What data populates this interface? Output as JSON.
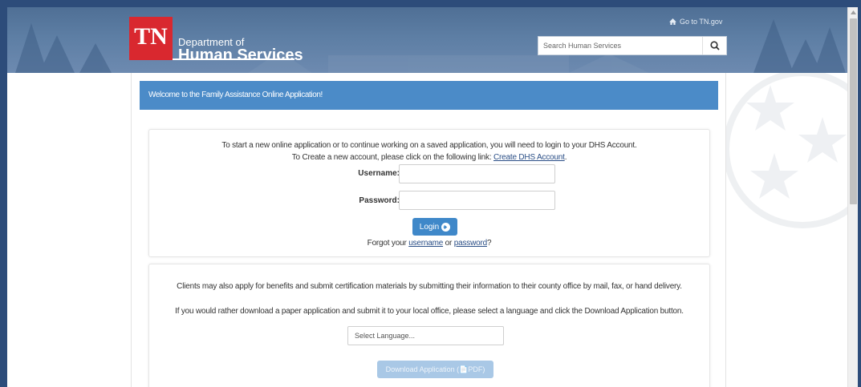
{
  "header": {
    "logo_text": "TN",
    "dept_prefix": "Department of",
    "dept_name": "Human Services",
    "goto_link": "Go to TN.gov",
    "search_placeholder": "Search Human Services"
  },
  "welcome_banner": "Welcome to the Family Assistance Online Application!",
  "login_card": {
    "intro_line1": "To start a new online application or to continue working on a saved application, you will need to login to your DHS Account.",
    "intro_line2_prefix": "To Create a new account, please click on the following link:",
    "create_account_link": "Create DHS Account",
    "intro_line2_suffix": ".",
    "username_label": "Username:",
    "password_label": "Password:",
    "login_button": "Login",
    "forgot_prefix": "Forgot your",
    "forgot_username": "username",
    "forgot_or": "or",
    "forgot_password": "password",
    "forgot_suffix": "?"
  },
  "paper_card": {
    "line1": "Clients may also apply for benefits and submit certification materials by submitting their information to their county office by mail, fax, or hand delivery.",
    "line2": "If you would rather download a paper application and submit it to your local office, please select a language and click the Download Application button.",
    "select_language": "Select Language...",
    "download_button": "Download Application (📄PDF)"
  },
  "colors": {
    "frame": "#2d4c7a",
    "banner": "#5d7ea4",
    "tn_red": "#d9282f",
    "welcome_bar": "#4b8bc8",
    "primary_button": "#3f88c9",
    "disabled_button": "#a9c8e6"
  }
}
